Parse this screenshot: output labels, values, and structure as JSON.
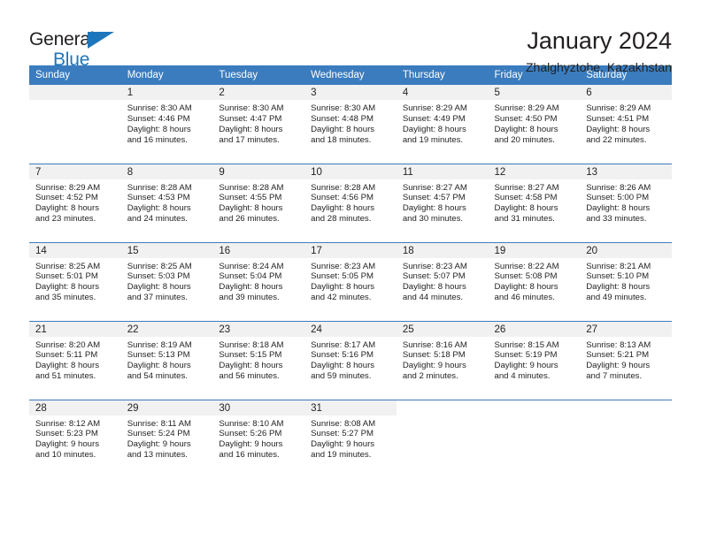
{
  "brand": {
    "word_one": "General",
    "word_two": "Blue",
    "accent_color": "#1d76bc"
  },
  "header": {
    "title": "January 2024",
    "subtitle": "Zhalghyztobe, Kazakhstan",
    "header_bg": "#3a7cbe"
  },
  "calendar": {
    "weekdays": [
      "Sunday",
      "Monday",
      "Tuesday",
      "Wednesday",
      "Thursday",
      "Friday",
      "Saturday"
    ],
    "weeks": [
      [
        {
          "day": "",
          "sunrise": "",
          "sunset": "",
          "daylight1": "",
          "daylight2": "",
          "empty": true
        },
        {
          "day": "1",
          "sunrise": "Sunrise: 8:30 AM",
          "sunset": "Sunset: 4:46 PM",
          "daylight1": "Daylight: 8 hours",
          "daylight2": "and 16 minutes."
        },
        {
          "day": "2",
          "sunrise": "Sunrise: 8:30 AM",
          "sunset": "Sunset: 4:47 PM",
          "daylight1": "Daylight: 8 hours",
          "daylight2": "and 17 minutes."
        },
        {
          "day": "3",
          "sunrise": "Sunrise: 8:30 AM",
          "sunset": "Sunset: 4:48 PM",
          "daylight1": "Daylight: 8 hours",
          "daylight2": "and 18 minutes."
        },
        {
          "day": "4",
          "sunrise": "Sunrise: 8:29 AM",
          "sunset": "Sunset: 4:49 PM",
          "daylight1": "Daylight: 8 hours",
          "daylight2": "and 19 minutes."
        },
        {
          "day": "5",
          "sunrise": "Sunrise: 8:29 AM",
          "sunset": "Sunset: 4:50 PM",
          "daylight1": "Daylight: 8 hours",
          "daylight2": "and 20 minutes."
        },
        {
          "day": "6",
          "sunrise": "Sunrise: 8:29 AM",
          "sunset": "Sunset: 4:51 PM",
          "daylight1": "Daylight: 8 hours",
          "daylight2": "and 22 minutes."
        }
      ],
      [
        {
          "day": "7",
          "sunrise": "Sunrise: 8:29 AM",
          "sunset": "Sunset: 4:52 PM",
          "daylight1": "Daylight: 8 hours",
          "daylight2": "and 23 minutes."
        },
        {
          "day": "8",
          "sunrise": "Sunrise: 8:28 AM",
          "sunset": "Sunset: 4:53 PM",
          "daylight1": "Daylight: 8 hours",
          "daylight2": "and 24 minutes."
        },
        {
          "day": "9",
          "sunrise": "Sunrise: 8:28 AM",
          "sunset": "Sunset: 4:55 PM",
          "daylight1": "Daylight: 8 hours",
          "daylight2": "and 26 minutes."
        },
        {
          "day": "10",
          "sunrise": "Sunrise: 8:28 AM",
          "sunset": "Sunset: 4:56 PM",
          "daylight1": "Daylight: 8 hours",
          "daylight2": "and 28 minutes."
        },
        {
          "day": "11",
          "sunrise": "Sunrise: 8:27 AM",
          "sunset": "Sunset: 4:57 PM",
          "daylight1": "Daylight: 8 hours",
          "daylight2": "and 30 minutes."
        },
        {
          "day": "12",
          "sunrise": "Sunrise: 8:27 AM",
          "sunset": "Sunset: 4:58 PM",
          "daylight1": "Daylight: 8 hours",
          "daylight2": "and 31 minutes."
        },
        {
          "day": "13",
          "sunrise": "Sunrise: 8:26 AM",
          "sunset": "Sunset: 5:00 PM",
          "daylight1": "Daylight: 8 hours",
          "daylight2": "and 33 minutes."
        }
      ],
      [
        {
          "day": "14",
          "sunrise": "Sunrise: 8:25 AM",
          "sunset": "Sunset: 5:01 PM",
          "daylight1": "Daylight: 8 hours",
          "daylight2": "and 35 minutes."
        },
        {
          "day": "15",
          "sunrise": "Sunrise: 8:25 AM",
          "sunset": "Sunset: 5:03 PM",
          "daylight1": "Daylight: 8 hours",
          "daylight2": "and 37 minutes."
        },
        {
          "day": "16",
          "sunrise": "Sunrise: 8:24 AM",
          "sunset": "Sunset: 5:04 PM",
          "daylight1": "Daylight: 8 hours",
          "daylight2": "and 39 minutes."
        },
        {
          "day": "17",
          "sunrise": "Sunrise: 8:23 AM",
          "sunset": "Sunset: 5:05 PM",
          "daylight1": "Daylight: 8 hours",
          "daylight2": "and 42 minutes."
        },
        {
          "day": "18",
          "sunrise": "Sunrise: 8:23 AM",
          "sunset": "Sunset: 5:07 PM",
          "daylight1": "Daylight: 8 hours",
          "daylight2": "and 44 minutes."
        },
        {
          "day": "19",
          "sunrise": "Sunrise: 8:22 AM",
          "sunset": "Sunset: 5:08 PM",
          "daylight1": "Daylight: 8 hours",
          "daylight2": "and 46 minutes."
        },
        {
          "day": "20",
          "sunrise": "Sunrise: 8:21 AM",
          "sunset": "Sunset: 5:10 PM",
          "daylight1": "Daylight: 8 hours",
          "daylight2": "and 49 minutes."
        }
      ],
      [
        {
          "day": "21",
          "sunrise": "Sunrise: 8:20 AM",
          "sunset": "Sunset: 5:11 PM",
          "daylight1": "Daylight: 8 hours",
          "daylight2": "and 51 minutes."
        },
        {
          "day": "22",
          "sunrise": "Sunrise: 8:19 AM",
          "sunset": "Sunset: 5:13 PM",
          "daylight1": "Daylight: 8 hours",
          "daylight2": "and 54 minutes."
        },
        {
          "day": "23",
          "sunrise": "Sunrise: 8:18 AM",
          "sunset": "Sunset: 5:15 PM",
          "daylight1": "Daylight: 8 hours",
          "daylight2": "and 56 minutes."
        },
        {
          "day": "24",
          "sunrise": "Sunrise: 8:17 AM",
          "sunset": "Sunset: 5:16 PM",
          "daylight1": "Daylight: 8 hours",
          "daylight2": "and 59 minutes."
        },
        {
          "day": "25",
          "sunrise": "Sunrise: 8:16 AM",
          "sunset": "Sunset: 5:18 PM",
          "daylight1": "Daylight: 9 hours",
          "daylight2": "and 2 minutes."
        },
        {
          "day": "26",
          "sunrise": "Sunrise: 8:15 AM",
          "sunset": "Sunset: 5:19 PM",
          "daylight1": "Daylight: 9 hours",
          "daylight2": "and 4 minutes."
        },
        {
          "day": "27",
          "sunrise": "Sunrise: 8:13 AM",
          "sunset": "Sunset: 5:21 PM",
          "daylight1": "Daylight: 9 hours",
          "daylight2": "and 7 minutes."
        }
      ],
      [
        {
          "day": "28",
          "sunrise": "Sunrise: 8:12 AM",
          "sunset": "Sunset: 5:23 PM",
          "daylight1": "Daylight: 9 hours",
          "daylight2": "and 10 minutes."
        },
        {
          "day": "29",
          "sunrise": "Sunrise: 8:11 AM",
          "sunset": "Sunset: 5:24 PM",
          "daylight1": "Daylight: 9 hours",
          "daylight2": "and 13 minutes."
        },
        {
          "day": "30",
          "sunrise": "Sunrise: 8:10 AM",
          "sunset": "Sunset: 5:26 PM",
          "daylight1": "Daylight: 9 hours",
          "daylight2": "and 16 minutes."
        },
        {
          "day": "31",
          "sunrise": "Sunrise: 8:08 AM",
          "sunset": "Sunset: 5:27 PM",
          "daylight1": "Daylight: 9 hours",
          "daylight2": "and 19 minutes."
        },
        {
          "day": "",
          "sunrise": "",
          "sunset": "",
          "daylight1": "",
          "daylight2": "",
          "blank": true
        },
        {
          "day": "",
          "sunrise": "",
          "sunset": "",
          "daylight1": "",
          "daylight2": "",
          "blank": true
        },
        {
          "day": "",
          "sunrise": "",
          "sunset": "",
          "daylight1": "",
          "daylight2": "",
          "blank": true
        }
      ]
    ]
  }
}
